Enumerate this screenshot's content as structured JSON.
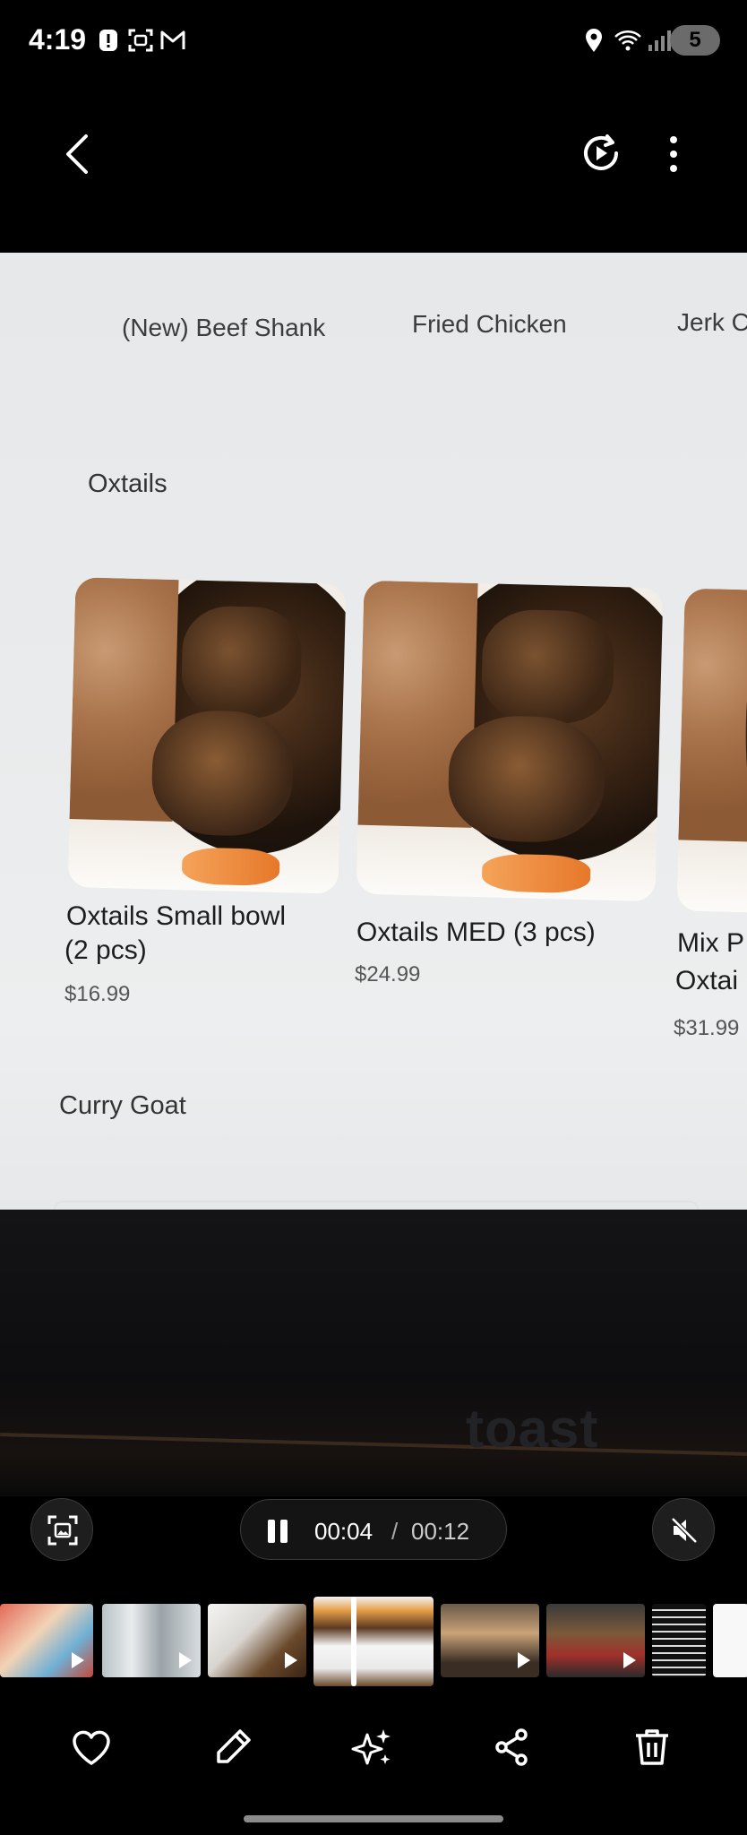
{
  "status_bar": {
    "time": "4:19",
    "notification_badge": "5"
  },
  "menu": {
    "category_tabs": [
      "(New) Beef Shank",
      "Fried Chicken",
      "Jerk C"
    ],
    "section_oxtails": "Oxtails",
    "items": [
      {
        "name_line1": "Oxtails Small  bowl",
        "name_line2": "(2 pcs)",
        "price": "$16.99"
      },
      {
        "name_line1": "Oxtails MED (3 pcs)",
        "name_line2": "",
        "price": "$24.99"
      },
      {
        "name_line1": "Mix P",
        "name_line2": "Oxtai",
        "price": "$31.99"
      }
    ],
    "section_curry": "Curry Goat",
    "brand_watermark": "toast"
  },
  "video": {
    "elapsed": "00:04",
    "separator": "/",
    "duration": "00:12",
    "progress_fraction": 0.33
  },
  "filmstrip": {
    "thumb_count": 8,
    "current_index": 3
  },
  "icons": {
    "back": "back-arrow-icon",
    "rotate": "auto-rotate-icon",
    "more": "more-vertical-icon",
    "capture": "capture-frame-icon",
    "mute": "muted-speaker-icon",
    "favorite": "heart-icon",
    "edit": "pencil-icon",
    "ai": "sparkle-icon",
    "share": "share-icon",
    "delete": "trash-icon"
  }
}
